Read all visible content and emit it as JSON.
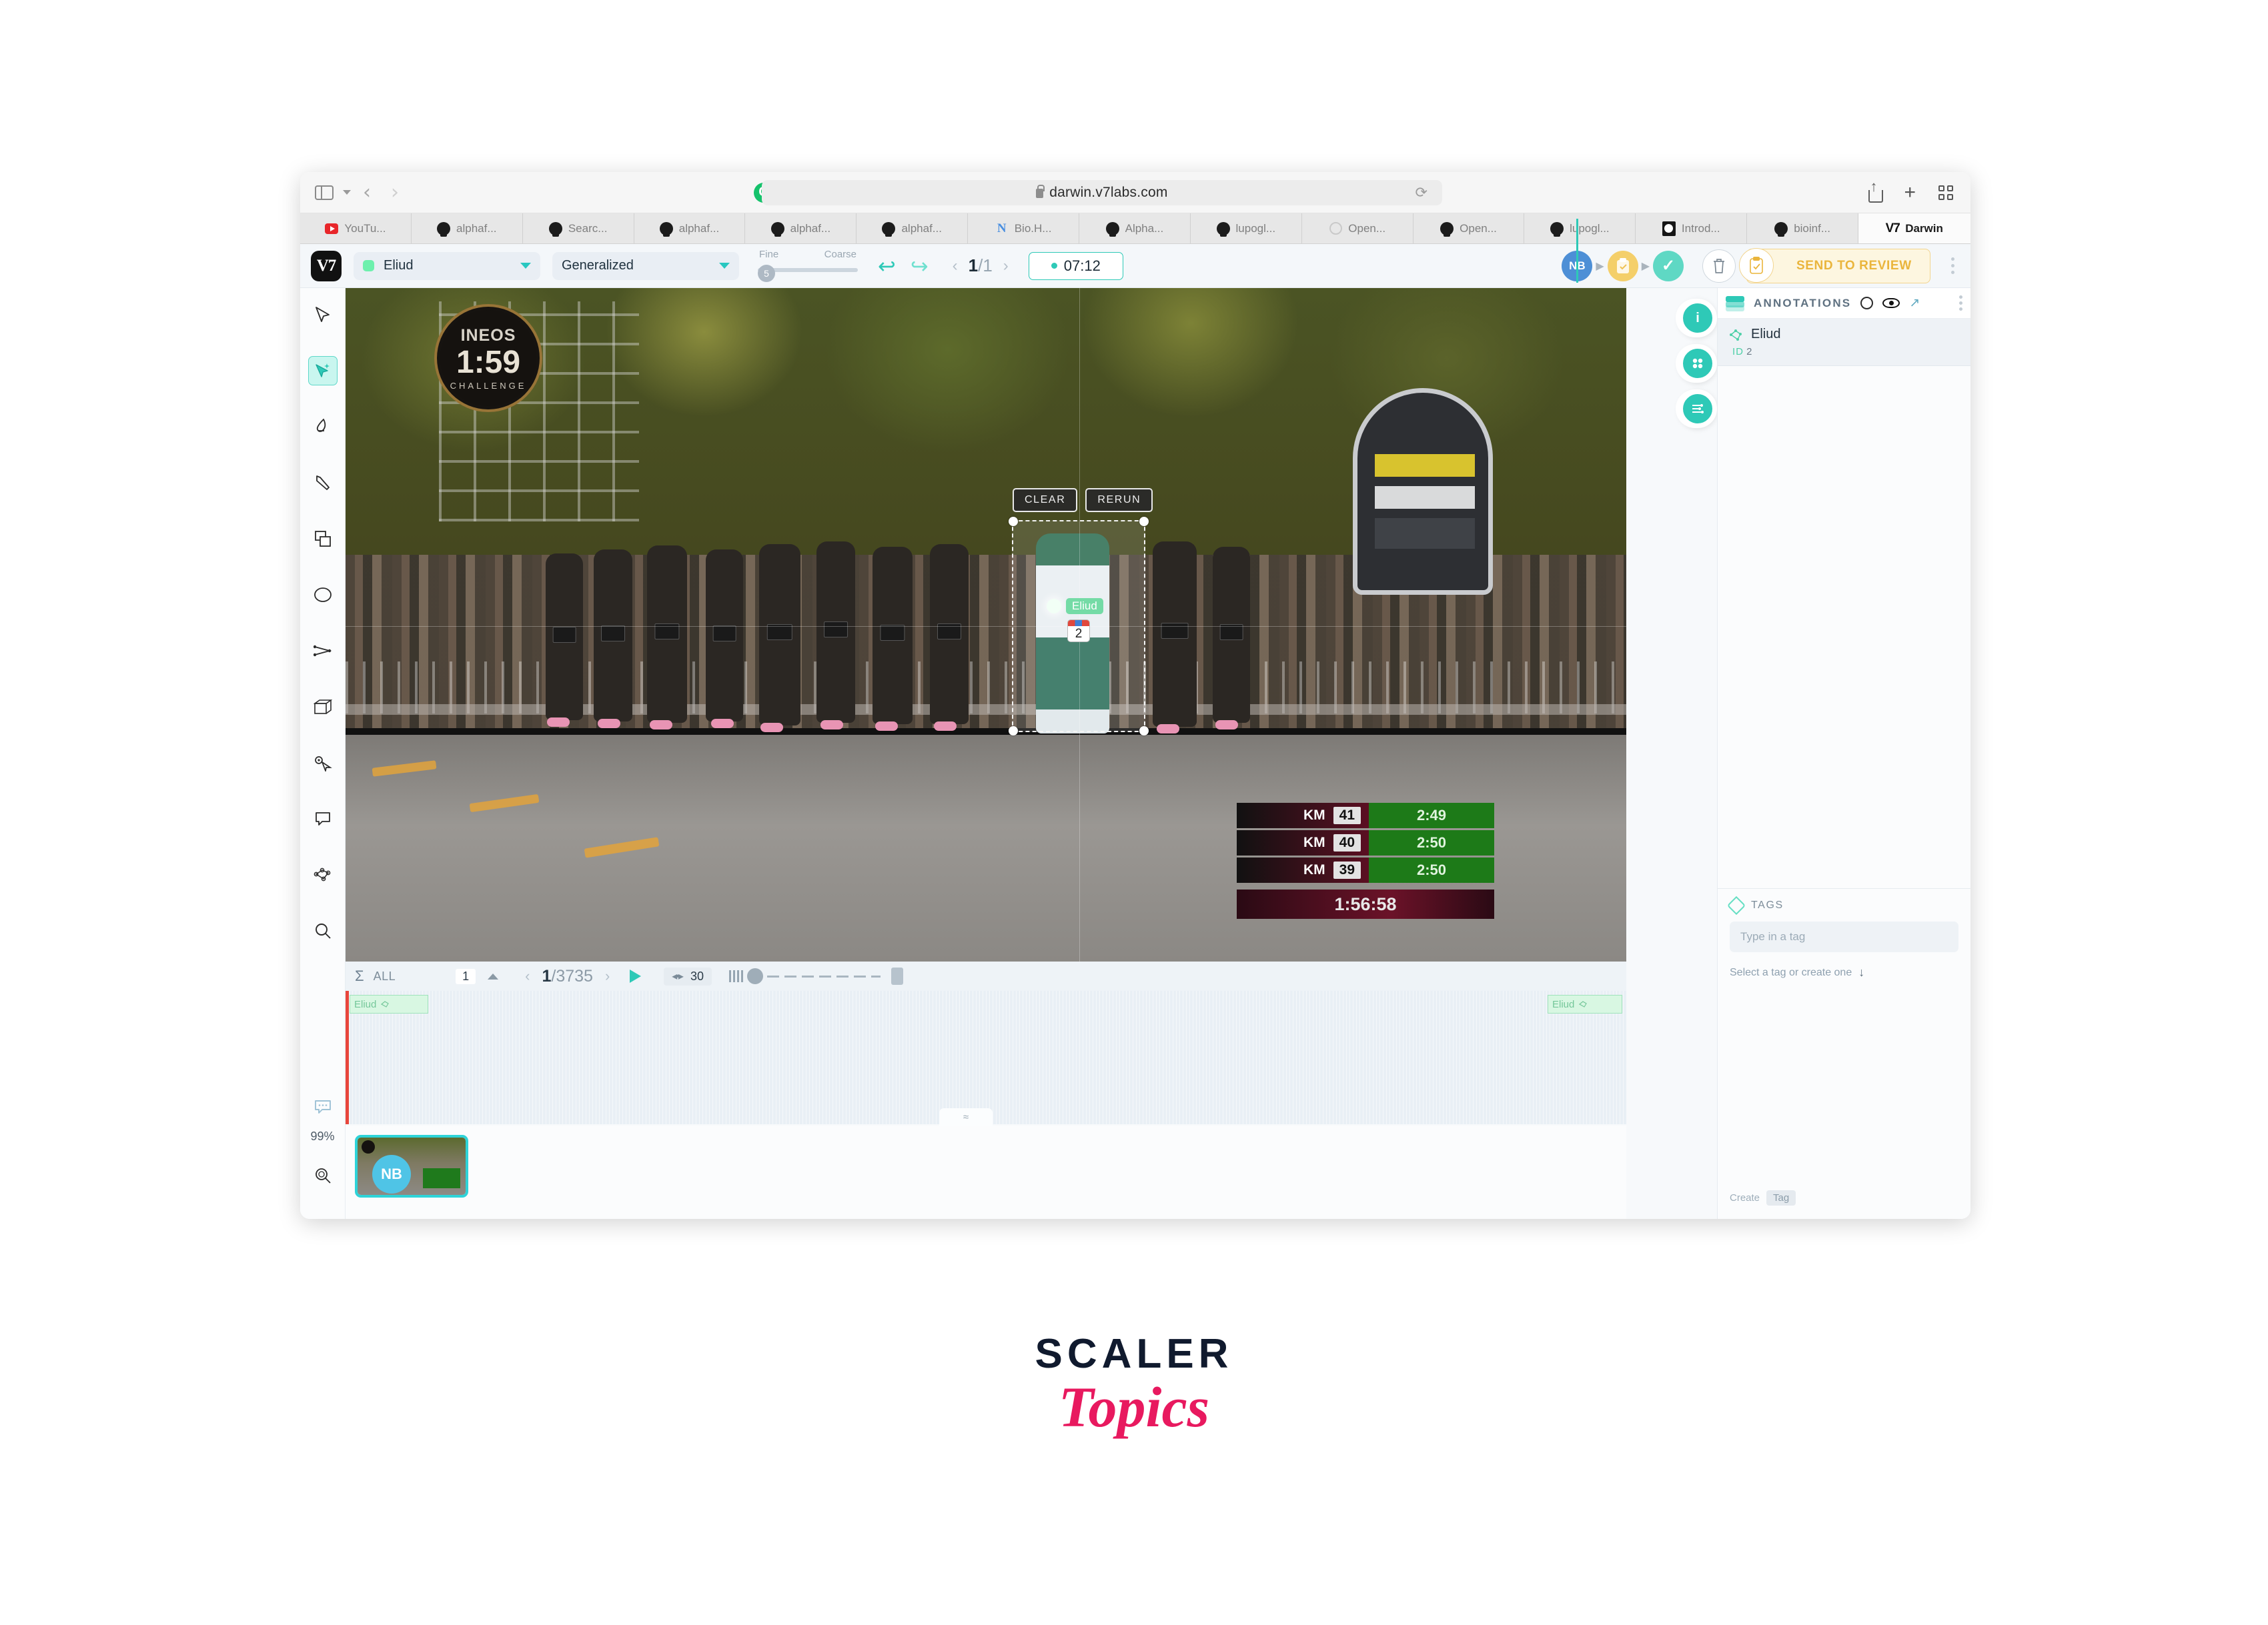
{
  "browser": {
    "url": "darwin.v7labs.com",
    "nav": {
      "back": "‹",
      "forward": "›",
      "reload": "⟳"
    },
    "tabs": [
      {
        "label": "YouTu...",
        "favicon": "youtube-icon",
        "active": false
      },
      {
        "label": "alphaf...",
        "favicon": "github-icon",
        "active": false
      },
      {
        "label": "Searc...",
        "favicon": "github-icon",
        "active": false
      },
      {
        "label": "alphaf...",
        "favicon": "github-icon",
        "active": false
      },
      {
        "label": "alphaf...",
        "favicon": "github-icon",
        "active": false
      },
      {
        "label": "alphaf...",
        "favicon": "github-icon",
        "active": false
      },
      {
        "label": "Bio.H...",
        "favicon": "biorender-icon",
        "active": false
      },
      {
        "label": "Alpha...",
        "favicon": "github-icon",
        "active": false
      },
      {
        "label": "lupogl...",
        "favicon": "github-icon",
        "active": false
      },
      {
        "label": "Open...",
        "favicon": "openai-icon",
        "active": false
      },
      {
        "label": "Open...",
        "favicon": "github-icon",
        "active": false
      },
      {
        "label": "lupogl...",
        "favicon": "github-icon",
        "active": false
      },
      {
        "label": "Introd...",
        "favicon": "github-dark-icon",
        "active": false
      },
      {
        "label": "bioinf...",
        "favicon": "github-icon",
        "active": false
      },
      {
        "label": "Darwin",
        "favicon": "v7-icon",
        "active": true
      }
    ]
  },
  "toolbar": {
    "logo": "V7",
    "class_select": {
      "value": "Eliud",
      "dot_color": "#6df0ad"
    },
    "type_select": {
      "value": "Generalized"
    },
    "slider": {
      "left_label": "Fine",
      "right_label": "Coarse",
      "value": "5"
    },
    "undo": "↩",
    "redo": "↪",
    "frame_nav": {
      "prev": "‹",
      "next": "›",
      "current": "1",
      "separator": "/",
      "total": "1"
    },
    "time_chip": "07:12",
    "stages": [
      {
        "label": "NB",
        "name": "user-avatar"
      },
      {
        "label": "",
        "name": "review-stage"
      },
      {
        "label": "✓",
        "name": "complete-stage"
      }
    ],
    "trash": "🗑",
    "send_to_review": "SEND TO REVIEW"
  },
  "tools": [
    {
      "name": "select-tool",
      "active": false
    },
    {
      "name": "auto-annotate-tool",
      "active": true
    },
    {
      "name": "brush-tool",
      "active": false
    },
    {
      "name": "pen-tool",
      "active": false
    },
    {
      "name": "bounding-box-tool",
      "active": false
    },
    {
      "name": "ellipse-tool",
      "active": false
    },
    {
      "name": "polyline-tool",
      "active": false
    },
    {
      "name": "cuboid-tool",
      "active": false
    },
    {
      "name": "keypoint-tool",
      "active": false
    },
    {
      "name": "comment-tool",
      "active": false
    },
    {
      "name": "skeleton-tool",
      "active": false
    },
    {
      "name": "magnifier-tool",
      "active": false
    }
  ],
  "zoom_level": "99%",
  "canvas": {
    "ineos_logo": {
      "line1": "INEOS",
      "line2": "1:59",
      "line3": "CHALLENGE"
    },
    "clear_button": "CLEAR",
    "rerun_button": "RERUN",
    "annotation_label": "Eliud",
    "annotation_id_badge": "2",
    "scoreboard": {
      "rows": [
        {
          "label": "KM",
          "km": "41",
          "split": "2:49"
        },
        {
          "label": "KM",
          "km": "40",
          "split": "2:50"
        },
        {
          "label": "KM",
          "km": "39",
          "split": "2:50"
        }
      ],
      "total": "1:56:58"
    }
  },
  "timeline": {
    "sum_icon": "Σ",
    "all_label": "ALL",
    "layer_count": "1",
    "prev": "‹",
    "next": "›",
    "frame_current": "1",
    "frame_separator": "/",
    "frame_total": "3735",
    "play": "▶",
    "fps": "30",
    "segment_label": "Eliud",
    "segment_label_end": "Eliud",
    "collapse": "≈"
  },
  "panel": {
    "annotations_title": "ANNOTATIONS",
    "items": [
      {
        "name": "Eliud",
        "id_key": "ID",
        "id_value": "2"
      }
    ],
    "tags_title": "TAGS",
    "tag_placeholder": "Type in a tag",
    "tag_hint": "Select a tag or create one",
    "footer_action": "Create",
    "footer_key": "Tag",
    "fabs": [
      {
        "name": "info-fab",
        "glyph": "i"
      },
      {
        "name": "clusters-fab",
        "glyph": "⌗"
      },
      {
        "name": "settings-fab",
        "glyph": "≔"
      }
    ]
  },
  "watermark": {
    "line1": "SCALER",
    "line2": "Topics"
  },
  "colors": {
    "accent_teal": "#2ec9b7",
    "review_yellow": "#eab53c",
    "playhead_red": "#e8463c",
    "class_green": "#6df0ad",
    "brand_pink": "#e8195f"
  }
}
